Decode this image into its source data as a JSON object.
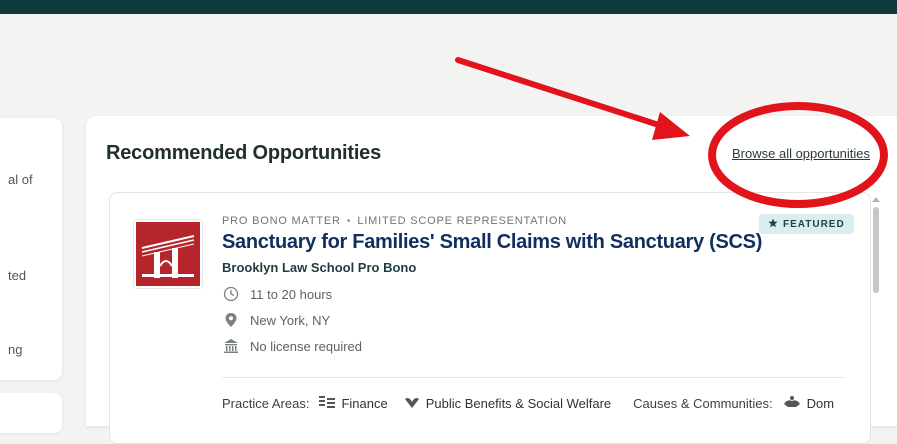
{
  "left_panel": {
    "fragments": [
      "al of",
      "ted",
      "ng"
    ]
  },
  "section": {
    "title": "Recommended Opportunities",
    "browse_link": "Browse all opportunities"
  },
  "opportunity": {
    "type": "PRO BONO MATTER",
    "subtype": "LIMITED SCOPE REPRESENTATION",
    "badge": "FEATURED",
    "title": "Sanctuary for Families' Small Claims with Sanctuary (SCS)",
    "organization": "Brooklyn Law School Pro Bono",
    "details": {
      "hours": "11 to 20 hours",
      "location": "New York, NY",
      "license": "No license required"
    },
    "practice_areas_label": "Practice Areas:",
    "practice_areas": [
      "Finance",
      "Public Benefits & Social Welfare"
    ],
    "causes_label": "Causes & Communities:",
    "causes": [
      "Dom"
    ]
  },
  "colors": {
    "topbar": "#0f3b3f",
    "title": "#102f5e",
    "badge_bg": "#d9eef0",
    "logo_red": "#b5252b",
    "annotation_red": "#e1141c"
  },
  "icons": {
    "hours": "clock-icon",
    "location": "map-pin-icon",
    "license": "courthouse-icon",
    "featured": "star-icon",
    "finance": "finance-icon",
    "public_benefits": "hands-leaf-icon",
    "causes": "hands-icon"
  }
}
